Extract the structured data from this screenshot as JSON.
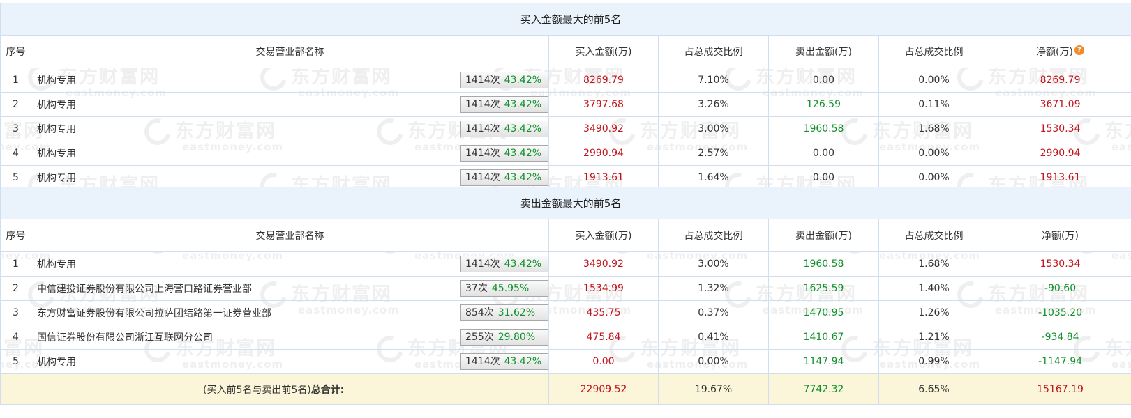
{
  "buy_section": {
    "title": "买入金额最大的前5名",
    "headers": [
      "序号",
      "交易营业部名称",
      "买入金额(万)",
      "占总成交比例",
      "卖出金额(万)",
      "占总成交比例",
      "净额(万)"
    ],
    "head_help_icon": "?",
    "rows": [
      {
        "no": "1",
        "name": "机构专用",
        "count": "1414次",
        "pct": "43.42%",
        "icon": "question-icon",
        "buy": "8269.79",
        "buy_ratio": "7.10%",
        "sell": "0.00",
        "sell_ratio": "0.00%",
        "net": "8269.79"
      },
      {
        "no": "2",
        "name": "机构专用",
        "count": "1414次",
        "pct": "43.42%",
        "icon": "arrow-right-icon",
        "buy": "3797.68",
        "buy_ratio": "3.26%",
        "sell": "126.59",
        "sell_ratio": "0.11%",
        "net": "3671.09"
      },
      {
        "no": "3",
        "name": "机构专用",
        "count": "1414次",
        "pct": "43.42%",
        "icon": "arrow-right-icon",
        "buy": "3490.92",
        "buy_ratio": "3.00%",
        "sell": "1960.58",
        "sell_ratio": "1.68%",
        "net": "1530.34"
      },
      {
        "no": "4",
        "name": "机构专用",
        "count": "1414次",
        "pct": "43.42%",
        "icon": "arrow-right-icon",
        "buy": "2990.94",
        "buy_ratio": "2.57%",
        "sell": "0.00",
        "sell_ratio": "0.00%",
        "net": "2990.94"
      },
      {
        "no": "5",
        "name": "机构专用",
        "count": "1414次",
        "pct": "43.42%",
        "icon": "arrow-right-icon",
        "buy": "1913.61",
        "buy_ratio": "1.64%",
        "sell": "0.00",
        "sell_ratio": "0.00%",
        "net": "1913.61"
      }
    ]
  },
  "sell_section": {
    "title": "卖出金额最大的前5名",
    "headers": [
      "序号",
      "交易营业部名称",
      "买入金额(万)",
      "占总成交比例",
      "卖出金额(万)",
      "占总成交比例",
      "净额(万)"
    ],
    "rows": [
      {
        "no": "1",
        "name": "机构专用",
        "count": "1414次",
        "pct": "43.42%",
        "icon": "question-icon",
        "buy": "3490.92",
        "buy_ratio": "3.00%",
        "sell": "1960.58",
        "sell_ratio": "1.68%",
        "net": "1530.34"
      },
      {
        "no": "2",
        "name": "中信建投证券股份有限公司上海营口路证券营业部",
        "count": "37次",
        "pct": "45.95%",
        "icon": "arrow-right-icon",
        "buy": "1534.99",
        "buy_ratio": "1.32%",
        "sell": "1625.59",
        "sell_ratio": "1.40%",
        "net": "-90.60"
      },
      {
        "no": "3",
        "name": "东方财富证券股份有限公司拉萨团结路第一证券营业部",
        "count": "854次",
        "pct": "31.62%",
        "icon": "arrow-right-icon",
        "buy": "435.75",
        "buy_ratio": "0.37%",
        "sell": "1470.95",
        "sell_ratio": "1.26%",
        "net": "-1035.20"
      },
      {
        "no": "4",
        "name": "国信证券股份有限公司浙江互联网分公司",
        "count": "255次",
        "pct": "29.80%",
        "icon": "arrow-right-icon",
        "buy": "475.84",
        "buy_ratio": "0.41%",
        "sell": "1410.67",
        "sell_ratio": "1.21%",
        "net": "-934.84"
      },
      {
        "no": "5",
        "name": "机构专用",
        "count": "1414次",
        "pct": "43.42%",
        "icon": "arrow-right-icon",
        "buy": "0.00",
        "buy_ratio": "0.00%",
        "sell": "1147.94",
        "sell_ratio": "0.99%",
        "net": "-1147.94"
      }
    ]
  },
  "total": {
    "label_prefix": "(买入前5名与卖出前5名)",
    "label_suffix": "总合计:",
    "buy": "22909.52",
    "buy_ratio": "19.67%",
    "sell": "7742.32",
    "sell_ratio": "6.65%",
    "net": "15167.19"
  },
  "watermark": {
    "cn": "东方财富网",
    "en": "eastmoney.com"
  },
  "colors": {
    "buy": "#c1141b",
    "sell": "#11922d",
    "positive": "#c1141b",
    "negative": "#11922d",
    "section_bg": "#eaf2fb",
    "total_bg": "#fbf6d9"
  }
}
